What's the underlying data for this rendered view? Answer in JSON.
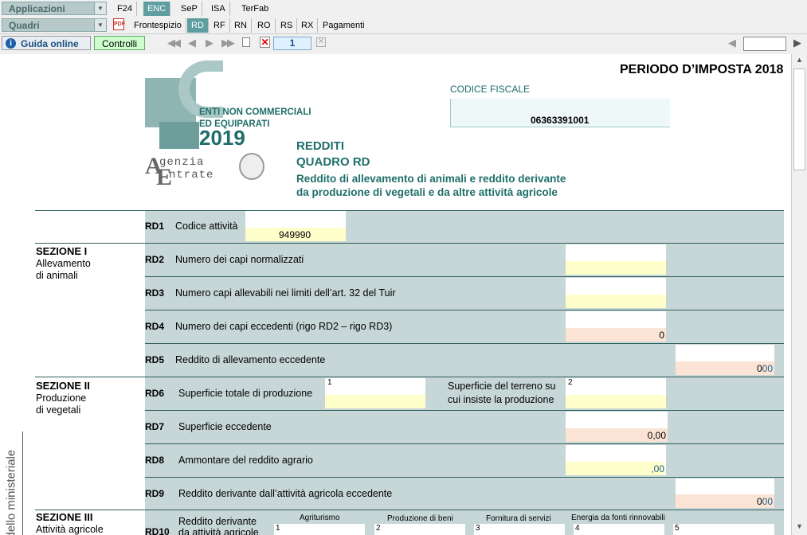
{
  "toolbar": {
    "applicazioni": "Applicazioni",
    "quadri": "Quadri",
    "tabs_row1": [
      "F24",
      "ENC",
      "SeP",
      "ISA",
      "TerFab"
    ],
    "tabs_row2": [
      "Frontespizio",
      "RD",
      "RF",
      "RN",
      "RO",
      "RS",
      "RX",
      "Pagamenti"
    ],
    "active_row1": "ENC",
    "active_row2": "RD",
    "guida": "Guida online",
    "controlli": "Controlli",
    "page_number": "1",
    "page_input": ""
  },
  "header": {
    "periodo": "PERIODO D’IMPOSTA 2018",
    "logo_line1": "ENTI NON COMMERCIALI",
    "logo_line2": "ED EQUIPARATI",
    "logo_year": "2019",
    "agenzia_line1": "genzia",
    "agenzia_line2": "ntrate",
    "codice_fiscale_label": "CODICE FISCALE",
    "codice_fiscale": "06363391001",
    "redditi": "REDDITI",
    "quadro": "QUADRO RD",
    "descr_line1": "Reddito di allevamento di animali e reddito derivante",
    "descr_line2": "da produzione di vegetali e da altre attività agricole"
  },
  "side_text": "dello ministeriale",
  "sections": {
    "s1_title": "SEZIONE I",
    "s1_sub1": "Allevamento",
    "s1_sub2": "di animali",
    "s2_title": "SEZIONE II",
    "s2_sub1": "Produzione",
    "s2_sub2": "di vegetali",
    "s3_title": "SEZIONE III",
    "s3_sub1": "Attività agricole"
  },
  "rows": {
    "rd1": {
      "code": "RD1",
      "label": "Codice attività",
      "value": "949990"
    },
    "rd2": {
      "code": "RD2",
      "label": "Numero dei capi normalizzati",
      "value": ""
    },
    "rd3": {
      "code": "RD3",
      "label": "Numero capi allevabili nei limiti dell’art. 32 del Tuir",
      "value": ""
    },
    "rd4": {
      "code": "RD4",
      "label": "Numero dei capi eccedenti (rigo RD2 – rigo RD3)",
      "value": "0"
    },
    "rd5": {
      "code": "RD5",
      "label": "Reddito di allevamento eccedente",
      "value": "0",
      "decimals": "00"
    },
    "rd6": {
      "code": "RD6",
      "label": "Superficie totale di produzione",
      "col1": "1",
      "label2_line1": "Superficie del terreno su",
      "label2_line2": "cui insiste la produzione",
      "col2": "2"
    },
    "rd7": {
      "code": "RD7",
      "label": "Superficie eccedente",
      "value": "0,00"
    },
    "rd8": {
      "code": "RD8",
      "label": "Ammontare del reddito agrario",
      "value": ",00"
    },
    "rd9": {
      "code": "RD9",
      "label": "Reddito derivante dall’attività agricola eccedente",
      "value": "0",
      "decimals": "00"
    },
    "rd10": {
      "code": "RD10",
      "label_line1": "Reddito derivante",
      "label_line2": "da attività agricole",
      "cols": [
        {
          "num": "1",
          "head": "Agriturismo"
        },
        {
          "num": "2",
          "head": "Produzione di beni"
        },
        {
          "num": "3",
          "head": "Fornitura di servizi"
        },
        {
          "num": "4",
          "head": "Energia da fonti rinnovabili"
        },
        {
          "num": "5",
          "head": ""
        }
      ]
    }
  }
}
